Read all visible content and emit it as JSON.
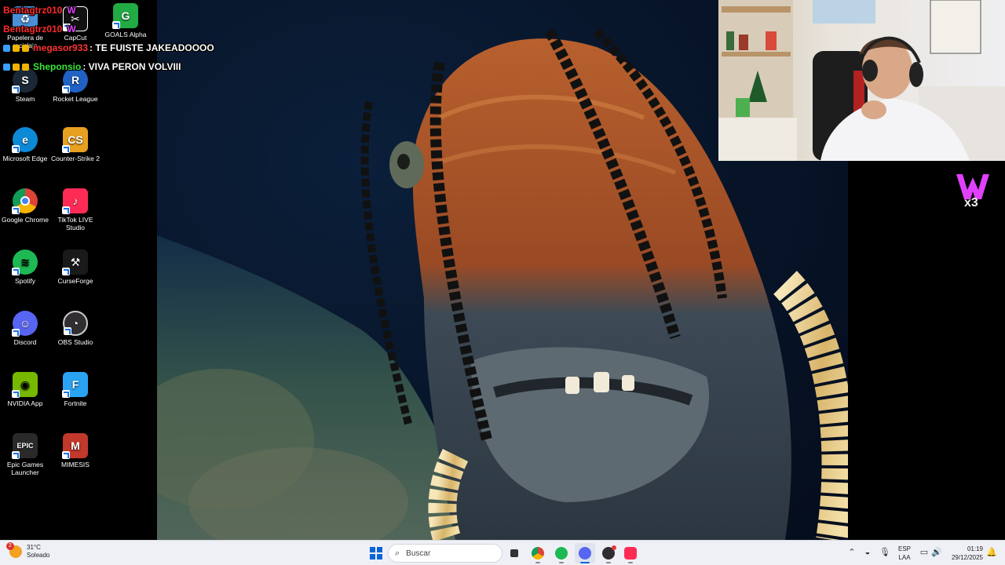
{
  "desktop": {
    "icons": [
      {
        "label": "Papelera de reciclaje",
        "icon": "recycle-bin-icon",
        "color": "#4a90d9"
      },
      {
        "label": "CapCut",
        "icon": "capcut-icon",
        "color": "#111111"
      },
      {
        "label": "GOALS Alpha",
        "icon": "goals-icon",
        "color": "#22aa44"
      },
      {
        "label": "Steam",
        "icon": "steam-icon",
        "color": "#1b2838"
      },
      {
        "label": "Rocket League",
        "icon": "rocket-league-icon",
        "color": "#1f62c4"
      },
      {
        "label": "Microsoft Edge",
        "icon": "edge-icon",
        "color": "#0c8ad6"
      },
      {
        "label": "Counter-Strike 2",
        "icon": "counter-strike-icon",
        "color": "#e8a020"
      },
      {
        "label": "Google Chrome",
        "icon": "chrome-icon",
        "color": "#db4437"
      },
      {
        "label": "TikTok LIVE Studio",
        "icon": "tiktok-icon",
        "color": "#fe2c55"
      },
      {
        "label": "Spotify",
        "icon": "spotify-icon",
        "color": "#1db954"
      },
      {
        "label": "CurseForge",
        "icon": "curseforge-icon",
        "color": "#1a1a1a"
      },
      {
        "label": "Discord",
        "icon": "discord-icon",
        "color": "#5865f2"
      },
      {
        "label": "OBS Studio",
        "icon": "obs-icon",
        "color": "#302e31"
      },
      {
        "label": "NVIDIA App",
        "icon": "nvidia-icon",
        "color": "#76b900"
      },
      {
        "label": "Fortnite",
        "icon": "fortnite-icon",
        "color": "#2aa3f2"
      },
      {
        "label": "Epic Games Launcher",
        "icon": "epic-games-icon",
        "color": "#2a2a2a"
      },
      {
        "label": "MIMESIS",
        "icon": "mimesis-icon",
        "color": "#c0392b"
      }
    ]
  },
  "chat": {
    "messages": [
      {
        "user": "Bentagtrz010",
        "text": "",
        "color": "#ff2a2a"
      },
      {
        "user": "Bentagtrz010",
        "text": "",
        "color": "#ff2a2a"
      },
      {
        "user": "megasor933",
        "text": ": TE FUISTE JAKEADOOOO",
        "color": "#ff3333"
      },
      {
        "user": "Sheponsio",
        "text": ": VIVA PERON VOLVIII",
        "color": "#39e639"
      }
    ]
  },
  "channel_logo": {
    "text": "x3",
    "accent": "#e040fb"
  },
  "taskbar": {
    "weather": {
      "temp": "31°C",
      "condition": "Soleado",
      "badge": "2"
    },
    "search_placeholder": "Buscar",
    "apps": [
      "windows-start-icon",
      "search-icon",
      "task-view-icon",
      "chrome-icon",
      "spotify-icon",
      "discord-icon",
      "obs-icon",
      "tiktok-icon"
    ],
    "lang": {
      "line1": "ESP",
      "line2": "LAA"
    },
    "clock": {
      "time": "01:19",
      "date": "29/12/2025"
    }
  }
}
